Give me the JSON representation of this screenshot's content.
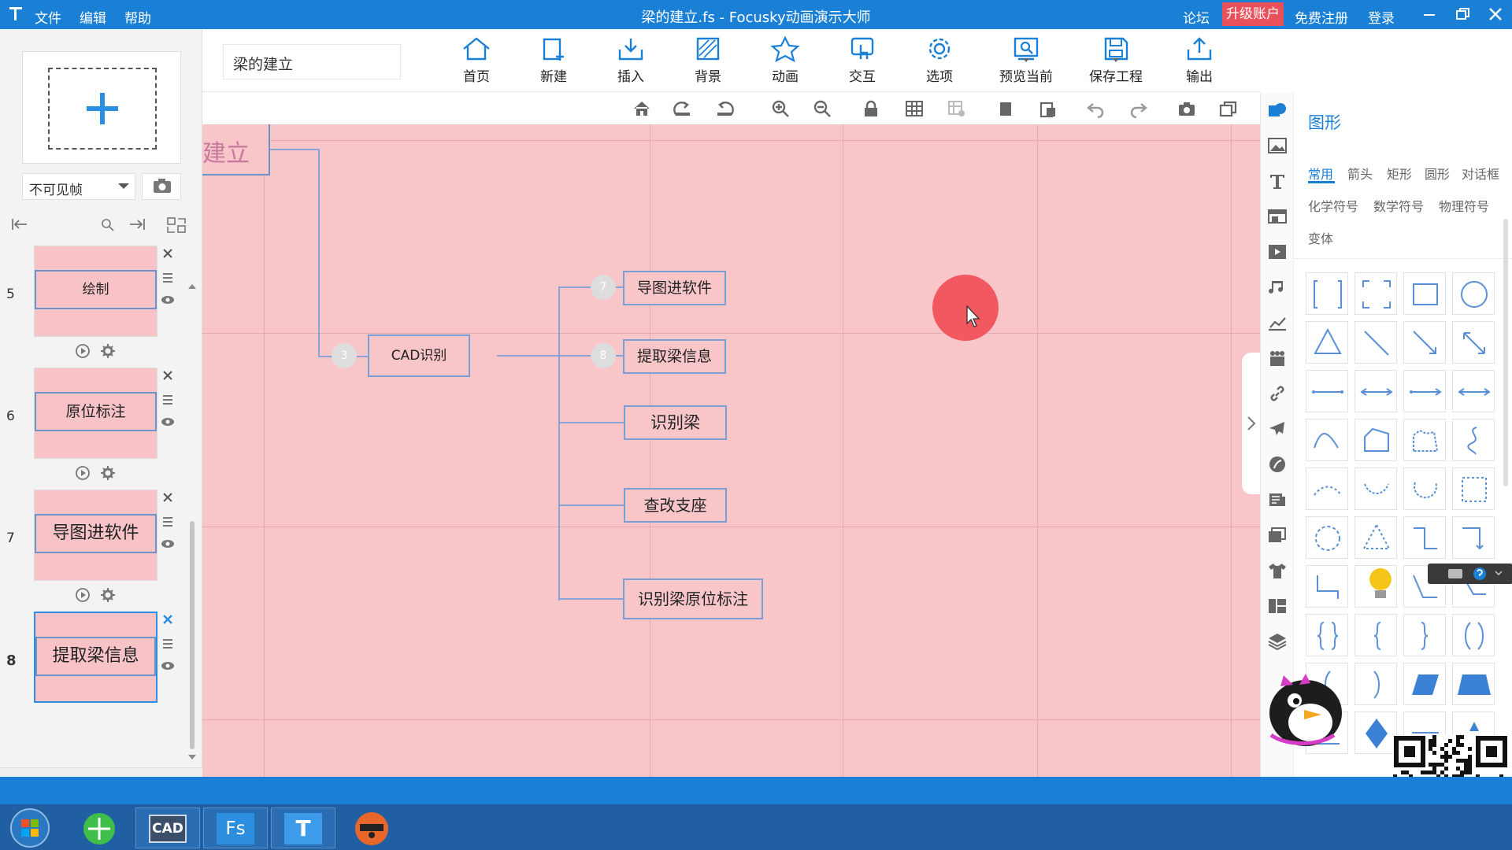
{
  "window": {
    "menu": [
      "文件",
      "编辑",
      "帮助"
    ],
    "title": "梁的建立.fs - Focusky动画演示大师",
    "right_links": {
      "forum": "论坛",
      "upgrade": "升级账户",
      "register": "免费注册",
      "login": "登录"
    }
  },
  "left_panel": {
    "frame_select_value": "不可见帧",
    "thumbnails": [
      {
        "num": "5",
        "label": "绘制"
      },
      {
        "num": "6",
        "label": "原位标注"
      },
      {
        "num": "7",
        "label": "导图进软件"
      },
      {
        "num": "8",
        "label": "提取梁信息"
      }
    ]
  },
  "toolbar": {
    "doc_name": "梁的建立",
    "buttons": {
      "home": "首页",
      "new": "新建",
      "insert": "插入",
      "background": "背景",
      "animation": "动画",
      "interact": "交互",
      "options": "选项",
      "preview": "预览当前",
      "save": "保存工程",
      "export": "输出"
    }
  },
  "canvas": {
    "partial_title": "建立",
    "root": {
      "badge": "3",
      "label": "CAD识别"
    },
    "children": [
      {
        "badge": "7",
        "label": "导图进软件"
      },
      {
        "badge": "8",
        "label": "提取梁信息"
      },
      {
        "badge": "",
        "label": "识别梁"
      },
      {
        "badge": "",
        "label": "查改支座"
      },
      {
        "badge": "",
        "label": "识别梁原位标注"
      }
    ]
  },
  "shapes_panel": {
    "title": "图形",
    "tabs_row1": [
      "常用",
      "箭头",
      "矩形",
      "圆形",
      "对话框"
    ],
    "tabs_row2": [
      "化学符号",
      "数学符号",
      "物理符号"
    ],
    "tabs_row3": [
      "变体"
    ],
    "active_tab": "常用"
  },
  "taskbar": {
    "apps": [
      "CAD",
      "Fs",
      "T"
    ]
  },
  "colors": {
    "accent_blue": "#1a80d6",
    "canvas_pink": "#f8c5c8",
    "upgrade_red": "#e8505a",
    "node_border": "#7a9fd4"
  }
}
